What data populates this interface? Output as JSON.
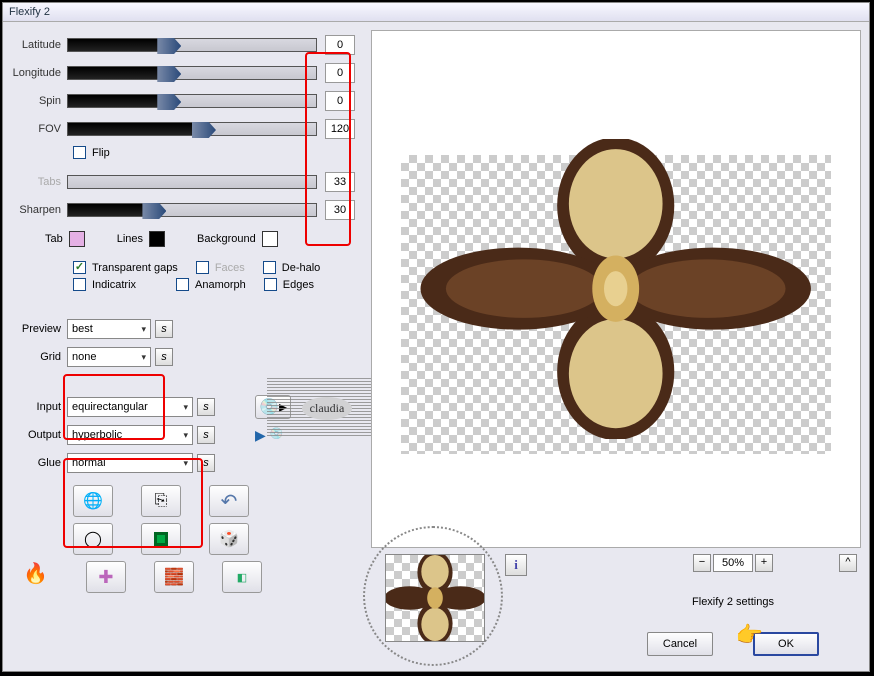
{
  "title": "Flexify 2",
  "sliders": {
    "latitude": {
      "label": "Latitude",
      "value": "0",
      "thumb_pct": 36,
      "gray_pct": 60
    },
    "longitude": {
      "label": "Longitude",
      "value": "0",
      "thumb_pct": 36,
      "gray_pct": 60
    },
    "spin": {
      "label": "Spin",
      "value": "0",
      "thumb_pct": 36,
      "gray_pct": 60
    },
    "fov": {
      "label": "FOV",
      "value": "120",
      "thumb_pct": 50,
      "gray_pct": 45
    },
    "tabs": {
      "label": "Tabs",
      "value": "33",
      "thumb_pct": 0,
      "gray_pct": 100
    },
    "sharpen": {
      "label": "Sharpen",
      "value": "30",
      "thumb_pct": 30,
      "gray_pct": 66
    }
  },
  "flip_label": "Flip",
  "colors": {
    "tab": {
      "label": "Tab",
      "hex": "#e4b0e4"
    },
    "lines": {
      "label": "Lines",
      "hex": "#000000"
    },
    "background": {
      "label": "Background",
      "hex": "#ffffff"
    }
  },
  "checks": {
    "transparent_gaps": {
      "label": "Transparent gaps",
      "on": true
    },
    "faces": {
      "label": "Faces",
      "on": false,
      "dim": true
    },
    "dehalo": {
      "label": "De-halo",
      "on": false
    },
    "indicatrix": {
      "label": "Indicatrix",
      "on": false
    },
    "anamorph": {
      "label": "Anamorph",
      "on": false
    },
    "edges": {
      "label": "Edges",
      "on": false
    }
  },
  "combos": {
    "preview": {
      "label": "Preview",
      "value": "best"
    },
    "grid": {
      "label": "Grid",
      "value": "none"
    },
    "input": {
      "label": "Input",
      "value": "equirectangular"
    },
    "output": {
      "label": "Output",
      "value": "hyperbolic"
    },
    "glue": {
      "label": "Glue",
      "value": "normal"
    }
  },
  "zoom": {
    "value": "50%"
  },
  "settings_text": "Flexify 2 settings",
  "buttons": {
    "cancel": "Cancel",
    "ok": "OK",
    "caret": "^"
  },
  "watermark": "claudia",
  "s_label": "s"
}
